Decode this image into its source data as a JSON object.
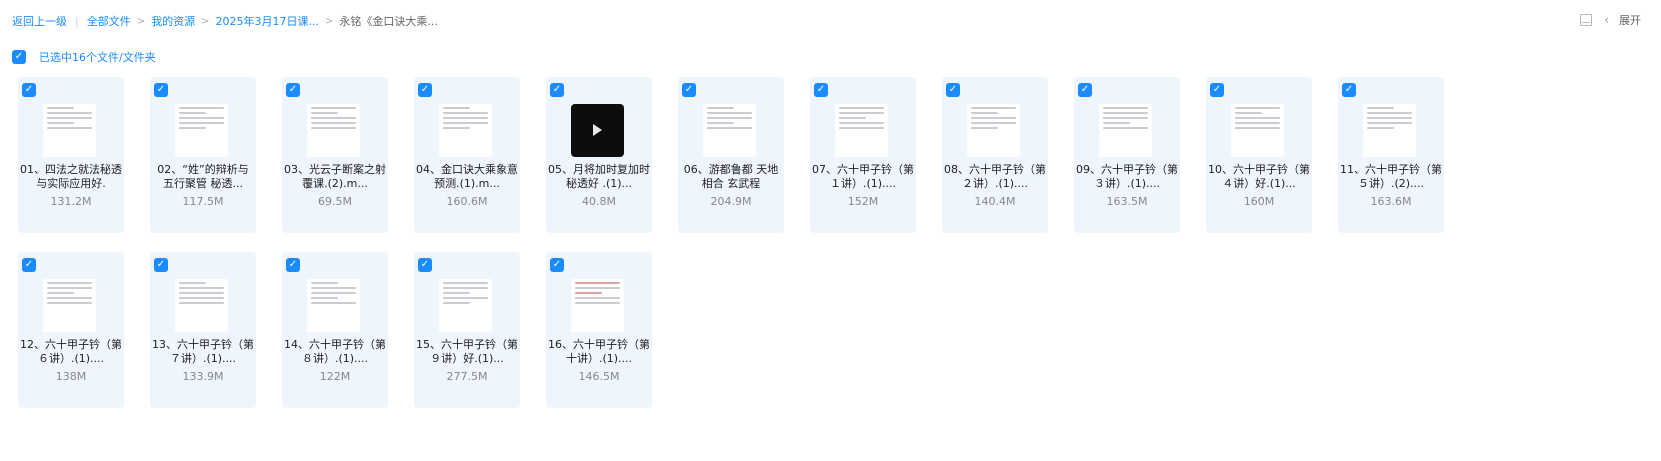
{
  "breadcrumb": {
    "back": "返回上一级",
    "all_files": "全部文件",
    "my_resources": "我的资源",
    "date_folder": "2025年3月17日课...",
    "current": "永铭《金口诀大乘..."
  },
  "toolbar": {
    "expand": "展开"
  },
  "selection": {
    "text": "已选中16个文件/文件夹"
  },
  "files": [
    {
      "name": "01、四法之就法秘透与实际应用好.",
      "size": "131.2M"
    },
    {
      "name": "02、“姓”的辩析与五行聚管 秘透...",
      "size": "117.5M"
    },
    {
      "name": "03、光云子断案之射覆课.(2).m...",
      "size": "69.5M"
    },
    {
      "name": "04、金口诀大乘象意预测.(1).m...",
      "size": "160.6M"
    },
    {
      "name": "05、月将加时复加时秘透好 .(1)...",
      "size": "40.8M"
    },
    {
      "name": "06、游都鲁都 天地相合 玄武程",
      "size": "204.9M"
    },
    {
      "name": "07、六十甲子钤（第１讲）.(1)....",
      "size": "152M"
    },
    {
      "name": "08、六十甲子钤（第２讲）.(1)....",
      "size": "140.4M"
    },
    {
      "name": "09、六十甲子钤（第３讲）.(1)....",
      "size": "163.5M"
    },
    {
      "name": "10、六十甲子钤（第４讲）好.(1)...",
      "size": "160M"
    },
    {
      "name": "11、六十甲子钤（第５讲）.(2)....",
      "size": "163.6M"
    },
    {
      "name": "12、六十甲子钤（第６讲）.(1)....",
      "size": "138M"
    },
    {
      "name": "13、六十甲子钤（第７讲）.(1)....",
      "size": "133.9M"
    },
    {
      "name": "14、六十甲子钤（第８讲）.(1)....",
      "size": "122M"
    },
    {
      "name": "15、六十甲子钤（第９讲）好.(1)...",
      "size": "277.5M"
    },
    {
      "name": "16、六十甲子钤（第十讲）.(1)....",
      "size": "146.5M"
    }
  ]
}
